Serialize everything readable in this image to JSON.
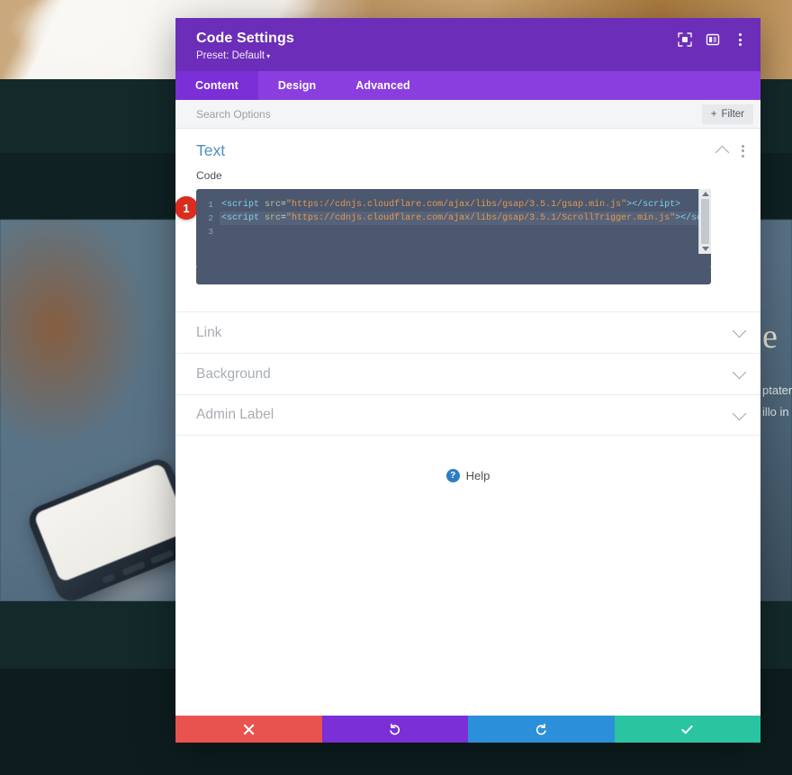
{
  "background": {
    "right_heading": "e",
    "right_paragraph_lines": "ptater\nillo in"
  },
  "modal": {
    "title": "Code Settings",
    "preset": "Preset: Default",
    "preset_caret": "▾",
    "header_icons": [
      {
        "name": "expand-icon",
        "label": "Expand"
      },
      {
        "name": "layout-split-icon",
        "label": "Layout"
      },
      {
        "name": "more-options-icon",
        "label": "More options"
      }
    ],
    "tabs": [
      {
        "label": "Content",
        "active": true
      },
      {
        "label": "Design",
        "active": false
      },
      {
        "label": "Advanced",
        "active": false
      }
    ],
    "search": {
      "placeholder": "Search Options",
      "value": ""
    },
    "filter_button": {
      "label": "Filter",
      "plus": "+"
    },
    "sections": {
      "text": {
        "title": "Text",
        "expanded": true,
        "code_label": "Code",
        "badge": "1",
        "code_lines": [
          {
            "number": "1",
            "highlighted": false,
            "tokens": [
              {
                "t": "tag",
                "v": "<script "
              },
              {
                "t": "attr",
                "v": "src"
              },
              {
                "t": "eq",
                "v": "="
              },
              {
                "t": "str",
                "v": "\"https://cdnjs.cloudflare.com/ajax/libs/gsap/3.5.1/gsap.min.js\""
              },
              {
                "t": "tag",
                "v": "></script>"
              }
            ]
          },
          {
            "number": "2",
            "highlighted": true,
            "tokens": [
              {
                "t": "tag",
                "v": "<script "
              },
              {
                "t": "attr",
                "v": "src"
              },
              {
                "t": "eq",
                "v": "="
              },
              {
                "t": "str",
                "v": "\"https://cdnjs.cloudflare.com/ajax/libs/gsap/3.5.1/ScrollTrigger.min.js\""
              },
              {
                "t": "tag",
                "v": "></script>"
              }
            ]
          },
          {
            "number": "3",
            "highlighted": false,
            "tokens": []
          }
        ]
      }
    },
    "accordion": [
      {
        "label": "Link"
      },
      {
        "label": "Background"
      },
      {
        "label": "Admin Label"
      }
    ],
    "help": {
      "icon_glyph": "?",
      "label": "Help"
    },
    "footer_buttons": [
      {
        "name": "cancel-button",
        "glyph": "close-icon",
        "color": "#e8534f"
      },
      {
        "name": "undo-button",
        "glyph": "undo-icon",
        "color": "#7b2fd6"
      },
      {
        "name": "redo-button",
        "glyph": "redo-icon",
        "color": "#2b8fd9"
      },
      {
        "name": "save-button",
        "glyph": "check-icon",
        "color": "#2bc4a0"
      }
    ]
  },
  "colors": {
    "header_purple": "#6c2eb9",
    "tabbar_purple": "#8a3ee0",
    "tab_active_purple": "#7b2fd6",
    "section_title_blue": "#4f8fba",
    "editor_bg": "#4b5870",
    "badge_red": "#d92d20",
    "help_blue": "#2d7dc4"
  }
}
